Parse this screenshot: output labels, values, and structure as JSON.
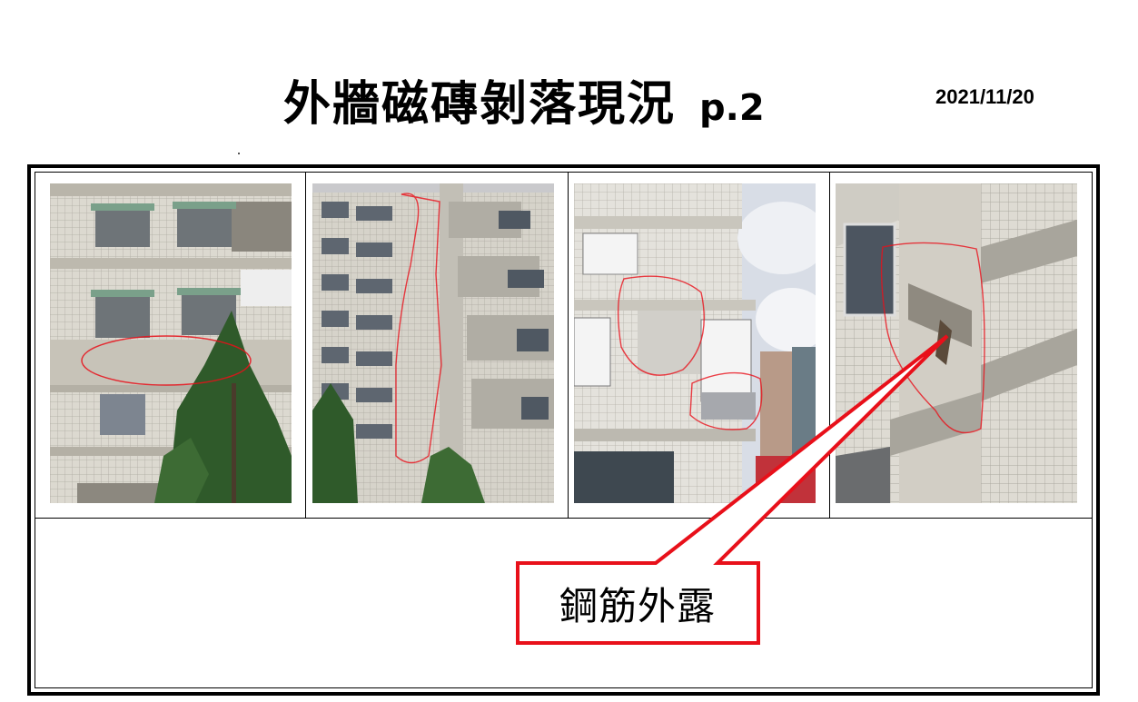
{
  "header": {
    "title": "外牆磁磚剝落現況",
    "page_label": "p.2",
    "date": "2021/11/20"
  },
  "photos": [
    {
      "subject": "building-facade-with-tree"
    },
    {
      "subject": "tall-building-facade"
    },
    {
      "subject": "building-corner-with-repair-patches"
    },
    {
      "subject": "tiled-corner-column"
    }
  ],
  "callout": {
    "label": "鋼筋外露",
    "color": "#e8101a"
  },
  "colors": {
    "tile": "#dcd9d0",
    "tile_grid": "#aeaba2",
    "annotation": "#e8101a",
    "sky": "#d8dde6",
    "tree": "#2f5a2a"
  }
}
